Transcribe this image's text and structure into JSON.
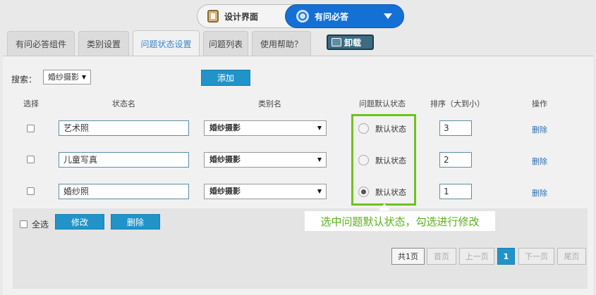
{
  "top_switch": {
    "left_label": "设计界面",
    "right_label": "有问必答"
  },
  "tabs": [
    {
      "label": "有问必答组件"
    },
    {
      "label": "类别设置"
    },
    {
      "label": "问题状态设置",
      "active": true
    },
    {
      "label": "问题列表"
    },
    {
      "label": "使用帮助？"
    }
  ],
  "uninstall_label": "卸载",
  "search": {
    "label": "搜索：",
    "selected": "婚纱摄影"
  },
  "add_label": "添加",
  "table": {
    "headers": [
      "选择",
      "状态名",
      "类别名",
      "问题默认状态",
      "排序（大到小）",
      "操作"
    ],
    "rows": [
      {
        "name": "艺术照",
        "category": "婚纱摄影",
        "default_label": "默认状态",
        "default_checked": false,
        "sort": "3",
        "action": "删除"
      },
      {
        "name": "儿童写真",
        "category": "婚纱摄影",
        "default_label": "默认状态",
        "default_checked": false,
        "sort": "2",
        "action": "删除"
      },
      {
        "name": "婚纱照",
        "category": "婚纱摄影",
        "default_label": "默认状态",
        "default_checked": true,
        "sort": "1",
        "action": "删除"
      }
    ]
  },
  "callout": "选中问题默认状态，勾选进行修改",
  "bottom": {
    "select_all": "全选",
    "modify": "修改",
    "delete": "删除"
  },
  "pagination": {
    "total": "共1页",
    "first": "首页",
    "prev": "上一页",
    "current": "1",
    "next": "下一页",
    "last": "尾页"
  },
  "colors": {
    "accent": "#2094c9",
    "highlight": "#6fc21e",
    "switch_active": "#1570d6"
  }
}
